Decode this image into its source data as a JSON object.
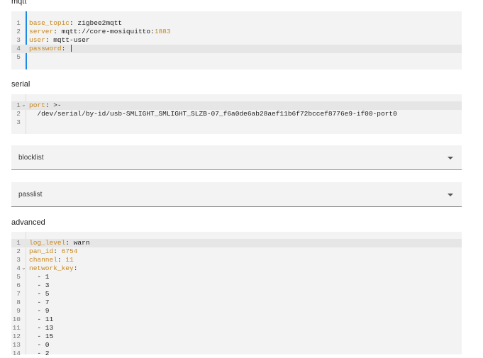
{
  "mqtt": {
    "title": "mqtt",
    "lines": [
      {
        "n": "1",
        "key": "base_topic",
        "sep": ": ",
        "val": "zigbee2mqtt"
      },
      {
        "n": "2",
        "key": "server",
        "sep": ": ",
        "val": "mqtt://core-mosiquitto:",
        "num": "1883"
      },
      {
        "n": "3",
        "key": "user",
        "sep": ": ",
        "val": "mqtt-user"
      },
      {
        "n": "4",
        "key": "password",
        "sep": ": ",
        "val": ""
      },
      {
        "n": "5",
        "key": "",
        "sep": "",
        "val": ""
      }
    ]
  },
  "serial": {
    "title": "serial",
    "lines": [
      {
        "n": "1",
        "key": "port",
        "sep": ": ",
        "val": ">-"
      },
      {
        "n": "2",
        "key": "",
        "sep": "",
        "val": "  /dev/serial/by-id/usb-SMLIGHT_SMLIGHT_SLZB-07_f6a0de6ab28aef11b6f72bccef8776e9-if00-port0"
      },
      {
        "n": "3",
        "key": "",
        "sep": "",
        "val": ""
      }
    ]
  },
  "blocklist": {
    "label": "blocklist"
  },
  "passlist": {
    "label": "passlist"
  },
  "advanced": {
    "title": "advanced",
    "lines": [
      {
        "n": "1",
        "key": "log_level",
        "sep": ": ",
        "val": "warn"
      },
      {
        "n": "2",
        "key": "pan_id",
        "sep": ": ",
        "num": "6754"
      },
      {
        "n": "3",
        "key": "channel",
        "sep": ": ",
        "num": "11"
      },
      {
        "n": "4",
        "key": "network_key",
        "sep": ":",
        "val": ""
      },
      {
        "n": "5",
        "val": "  - 1"
      },
      {
        "n": "6",
        "val": "  - 3"
      },
      {
        "n": "7",
        "val": "  - 5"
      },
      {
        "n": "8",
        "val": "  - 7"
      },
      {
        "n": "9",
        "val": "  - 9"
      },
      {
        "n": "10",
        "val": "  - 11"
      },
      {
        "n": "11",
        "val": "  - 13"
      },
      {
        "n": "12",
        "val": "  - 15"
      },
      {
        "n": "13",
        "val": "  - 0"
      },
      {
        "n": "14",
        "val": "  - 2"
      }
    ]
  }
}
